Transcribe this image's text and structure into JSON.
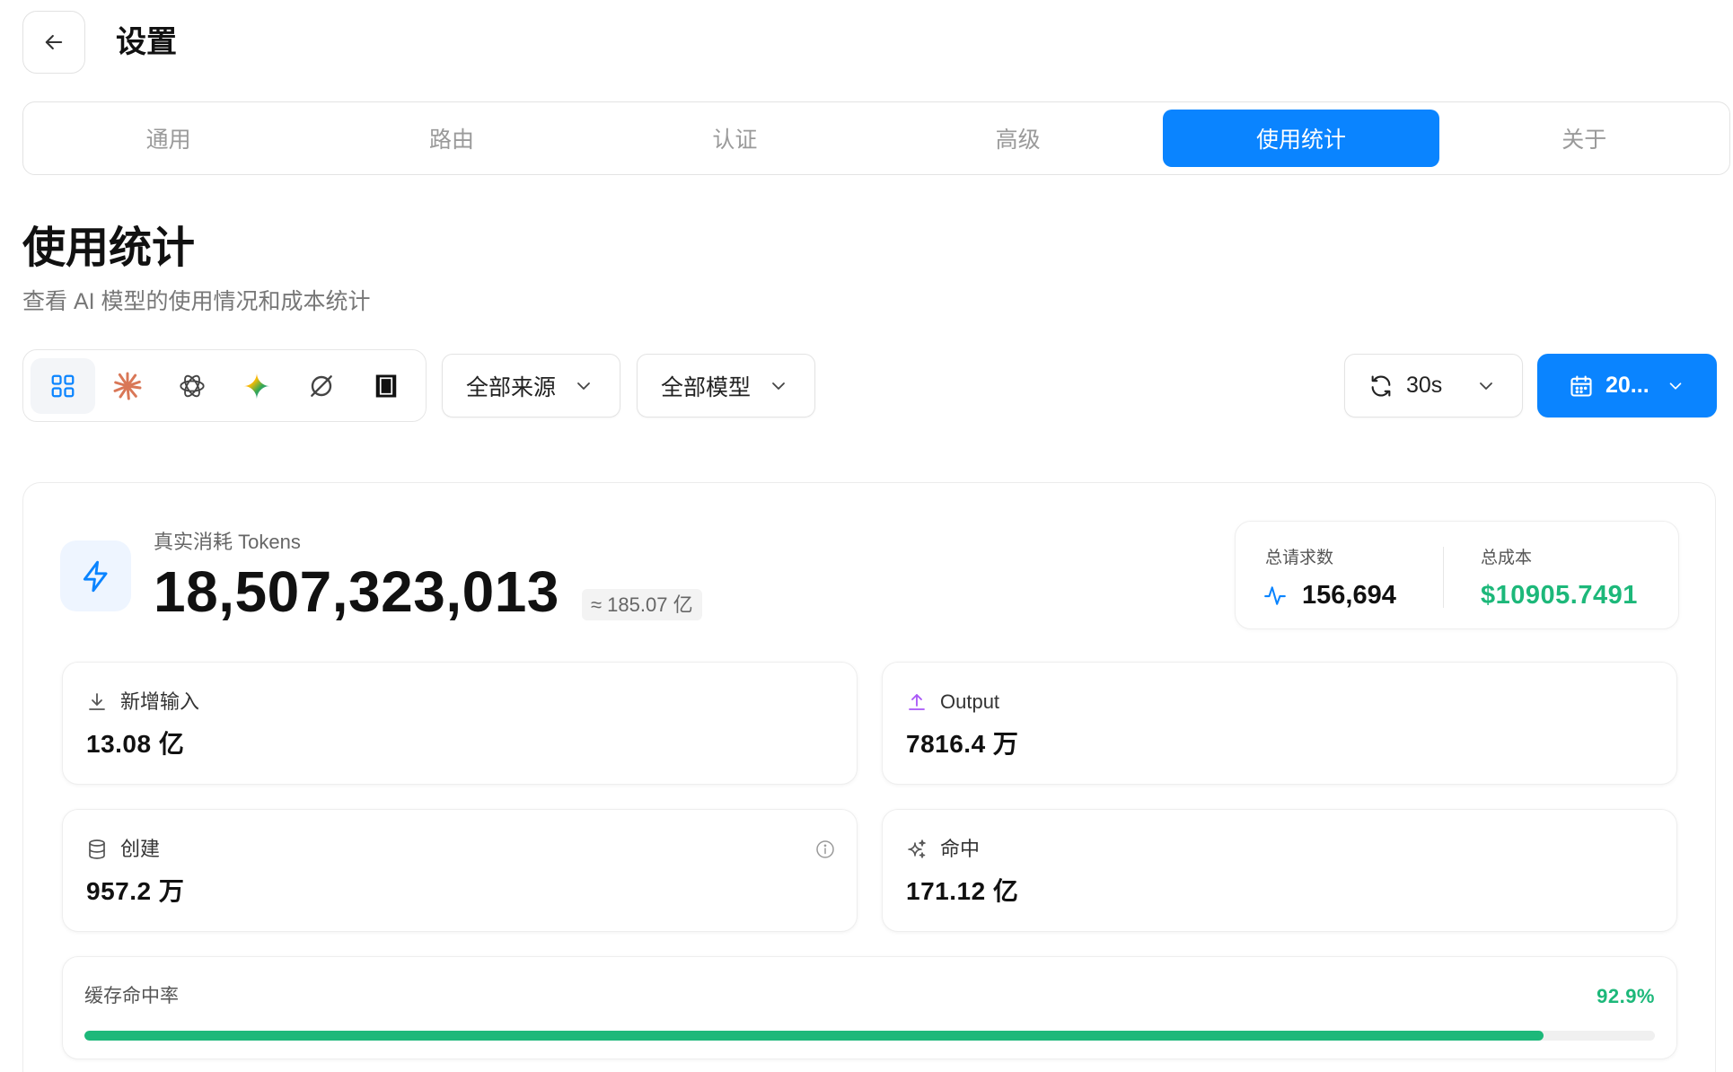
{
  "header": {
    "title": "设置"
  },
  "tabs": [
    {
      "label": "通用"
    },
    {
      "label": "路由"
    },
    {
      "label": "认证"
    },
    {
      "label": "高级"
    },
    {
      "label": "使用统计",
      "active": true
    },
    {
      "label": "关于"
    }
  ],
  "page": {
    "title": "使用统计",
    "subtitle": "查看 AI 模型的使用情况和成本统计"
  },
  "filters": {
    "sources": [
      {
        "icon": "grid-icon",
        "selected": true
      },
      {
        "icon": "anthropic-icon"
      },
      {
        "icon": "openai-icon"
      },
      {
        "icon": "gemini-icon"
      },
      {
        "icon": "ring-slash-icon"
      },
      {
        "icon": "square-frame-icon"
      }
    ],
    "source_select": "全部来源",
    "model_select": "全部模型",
    "refresh_interval": "30s",
    "date_range": "20..."
  },
  "tokens": {
    "label": "真实消耗 Tokens",
    "total": "18,507,323,013",
    "approx": "≈ 185.07 亿"
  },
  "summary": {
    "requests_label": "总请求数",
    "requests_value": "156,694",
    "cost_label": "总成本",
    "cost_value": "$10905.7491"
  },
  "breakdown": {
    "input": {
      "label": "新增输入",
      "value": "13.08 亿"
    },
    "output": {
      "label": "Output",
      "value": "7816.4 万"
    },
    "cache_create": {
      "label": "创建",
      "value": "957.2 万"
    },
    "cache_hit": {
      "label": "命中",
      "value": "171.12 亿"
    }
  },
  "cache_rate": {
    "label": "缓存命中率",
    "value": "92.9%",
    "fraction": 0.929
  },
  "colors": {
    "accent": "#0a84ff",
    "success": "#1db87a",
    "output": "#a855f7",
    "anthropic": "#d97757"
  }
}
